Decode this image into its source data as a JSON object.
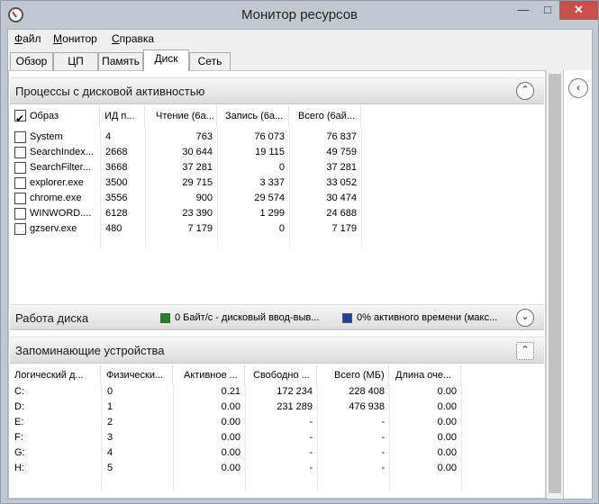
{
  "window": {
    "title": "Монитор ресурсов"
  },
  "menu": [
    "Файл",
    "Монитор",
    "Справка"
  ],
  "tabs": [
    "Обзор",
    "ЦП",
    "Память",
    "Диск",
    "Сеть"
  ],
  "active_tab": "Диск",
  "disk_processes": {
    "title": "Процессы с дисковой активностью",
    "columns": [
      "Образ",
      "ИД п...",
      "Чтение (6а...",
      "Запись (6а...",
      "Всего (6ай..."
    ],
    "rows": [
      {
        "image": "System",
        "pid": "4",
        "read": "763",
        "write": "76 073",
        "total": "76 837"
      },
      {
        "image": "SearchIndex...",
        "pid": "2668",
        "read": "30 644",
        "write": "19 115",
        "total": "49 759"
      },
      {
        "image": "SearchFilter...",
        "pid": "3668",
        "read": "37 281",
        "write": "0",
        "total": "37 281"
      },
      {
        "image": "explorer.exe",
        "pid": "3500",
        "read": "29 715",
        "write": "3 337",
        "total": "33 052"
      },
      {
        "image": "chrome.exe",
        "pid": "3556",
        "read": "900",
        "write": "29 574",
        "total": "30 474"
      },
      {
        "image": "WINWORD....",
        "pid": "6128",
        "read": "23 390",
        "write": "1 299",
        "total": "24 688"
      },
      {
        "image": "gzserv.exe",
        "pid": "480",
        "read": "7 179",
        "write": "0",
        "total": "7 179"
      }
    ]
  },
  "disk_activity": {
    "title": "Работа диска",
    "legend_io": "0 Байт/с - дисковый ввод-выв...",
    "legend_active": "0% активного времени (макс...",
    "io_color": "#1a8a1a",
    "active_color": "#1c3fa8"
  },
  "storage": {
    "title": "Запоминающие устройства",
    "columns": [
      "Логический д...",
      "Физически...",
      "Активное ...",
      "Свободно ...",
      "Всего (МБ)",
      "Длина оче..."
    ],
    "rows": [
      {
        "logical": "C:",
        "physical": "0",
        "active": "0.21",
        "free": "172 234",
        "total": "228 408",
        "queue": "0.00"
      },
      {
        "logical": "D:",
        "physical": "1",
        "active": "0.00",
        "free": "231 289",
        "total": "476 938",
        "queue": "0.00"
      },
      {
        "logical": "E:",
        "physical": "2",
        "active": "0.00",
        "free": "-",
        "total": "-",
        "queue": "0.00"
      },
      {
        "logical": "F:",
        "physical": "3",
        "active": "0.00",
        "free": "-",
        "total": "-",
        "queue": "0.00"
      },
      {
        "logical": "G:",
        "physical": "4",
        "active": "0.00",
        "free": "-",
        "total": "-",
        "queue": "0.00"
      },
      {
        "logical": "H:",
        "physical": "5",
        "active": "0.00",
        "free": "-",
        "total": "-",
        "queue": "0.00"
      }
    ]
  },
  "icons": {
    "collapse": "chevron-up-icon",
    "expand": "chevron-down-icon",
    "pane_toggle": "chevron-left-icon"
  }
}
